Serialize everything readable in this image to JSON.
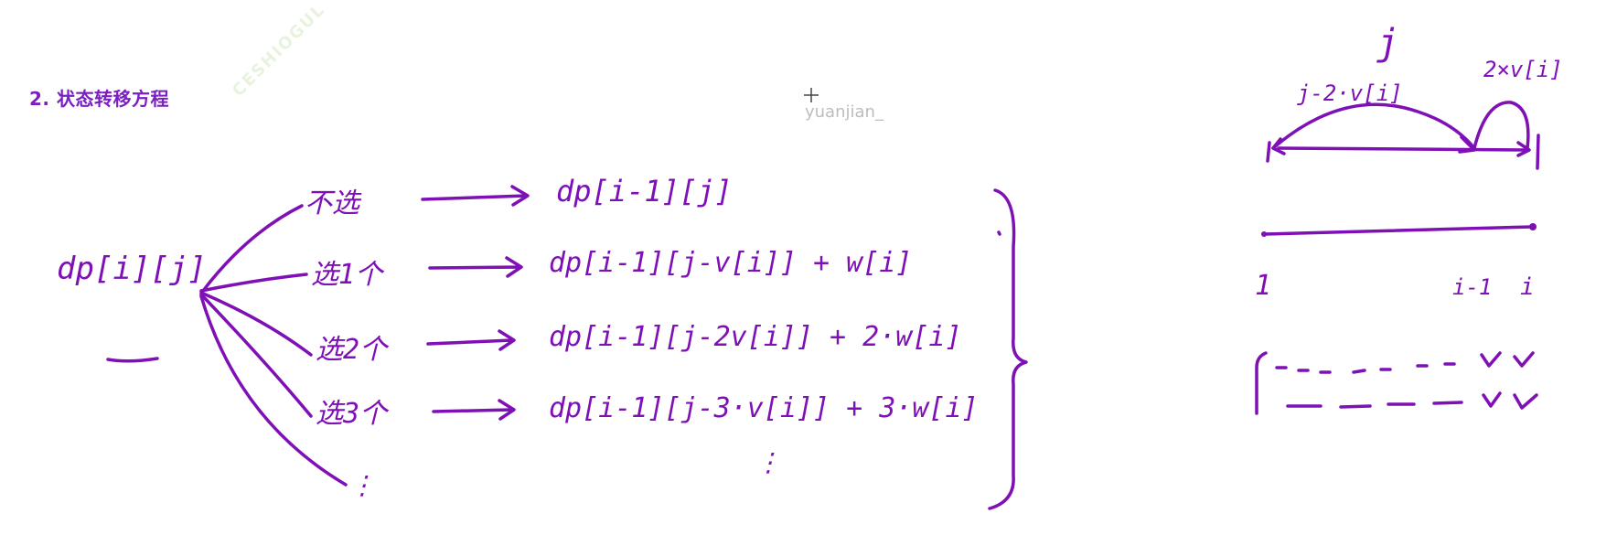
{
  "heading": "2. 状态转移方程",
  "cursor_label": "yuanjian_",
  "watermark": "CESHIOGUL",
  "left_diagram": {
    "root": "dp[i][j]",
    "branches": [
      {
        "choice": "不选",
        "result": "dp[i-1][j]"
      },
      {
        "choice": "选1个",
        "result": "dp[i-1][j-v[i]] + w[i]"
      },
      {
        "choice": "选2个",
        "result": "dp[i-1][j-2v[i]] + 2·w[i]"
      },
      {
        "choice": "选3个",
        "result": "dp[i-1][j-3·v[i]] + 3·w[i]"
      },
      {
        "choice": "⋮",
        "result": "⋮"
      }
    ]
  },
  "right_diagram": {
    "top_label": "j",
    "left_arc_label": "j-2·v[i]",
    "right_arc_label": "2×v[i]",
    "axis_labels": [
      "1",
      "i-1",
      "i"
    ]
  },
  "colors": {
    "ink": "#7e10b6",
    "heading": "#7b1fc2",
    "cursor_text": "#bdbdbd"
  }
}
